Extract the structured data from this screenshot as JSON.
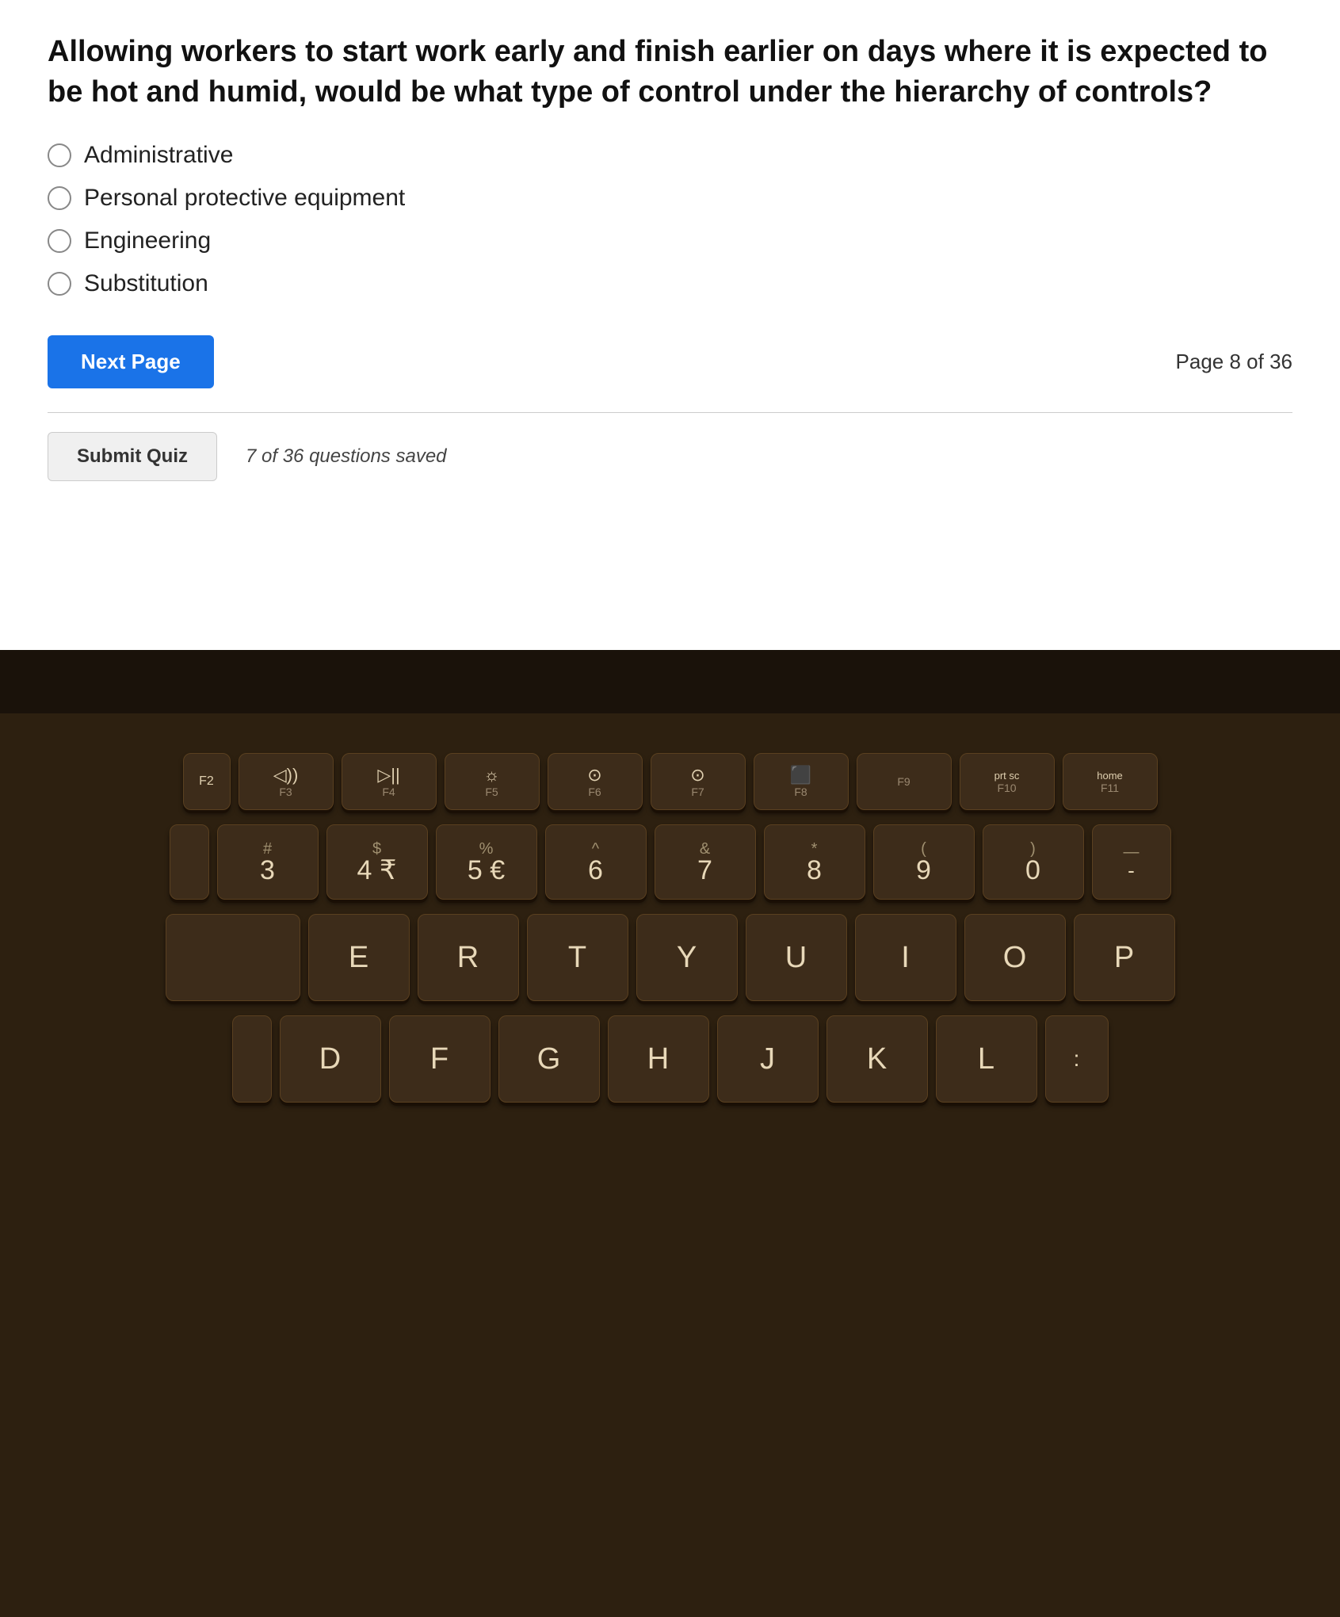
{
  "quiz": {
    "question": "Allowing workers to start work early and finish earlier on days where it is expected to be hot and humid, would be what type of control under the hierarchy of controls?",
    "options": [
      {
        "id": "opt1",
        "label": "Administrative"
      },
      {
        "id": "opt2",
        "label": "Personal protective equipment"
      },
      {
        "id": "opt3",
        "label": "Engineering"
      },
      {
        "id": "opt4",
        "label": "Substitution"
      }
    ],
    "next_page_label": "Next Page",
    "page_indicator": "Page 8 of 36",
    "submit_label": "Submit Quiz",
    "saved_text": "7 of 36 questions saved"
  },
  "keyboard": {
    "fn_row": [
      {
        "top": "◁))",
        "bottom": "F3"
      },
      {
        "top": "▷||",
        "bottom": "F4"
      },
      {
        "top": "☼",
        "bottom": "F5"
      },
      {
        "top": "⊙",
        "bottom": "F6"
      },
      {
        "top": "⊙+",
        "bottom": "F7"
      },
      {
        "top": "⬛",
        "bottom": "F8"
      },
      {
        "top": "",
        "bottom": "F9"
      },
      {
        "top": "prt sc",
        "bottom": "F10"
      },
      {
        "top": "home",
        "bottom": "F11"
      }
    ],
    "num_row": [
      {
        "top": "#",
        "bottom": "3"
      },
      {
        "top": "$",
        "bottom": "4 ₹"
      },
      {
        "top": "%",
        "bottom": "5 €"
      },
      {
        "top": "^",
        "bottom": "6"
      },
      {
        "top": "&",
        "bottom": "7"
      },
      {
        "top": "*",
        "bottom": "8"
      },
      {
        "top": "(",
        "bottom": "9"
      },
      {
        "top": ")",
        "bottom": "0"
      },
      {
        "top": "—",
        "bottom": "-"
      }
    ],
    "letter_row1": [
      "E",
      "R",
      "T",
      "Y",
      "U",
      "I",
      "O",
      "P"
    ],
    "letter_row2": [
      "D",
      "F",
      "G",
      "H",
      "J",
      "K",
      "L"
    ]
  }
}
